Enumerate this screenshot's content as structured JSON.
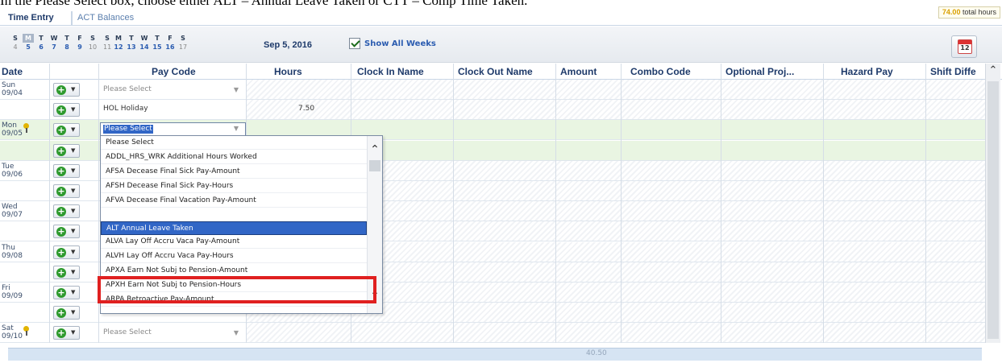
{
  "caption": "In the Please Select box, choose either ALT – Annual Leave Taken or CTT – Comp Time Taken.",
  "tabs": [
    "Time Entry",
    "ACT Balances"
  ],
  "total_hours": {
    "value": "74.00",
    "label": "total hours"
  },
  "calendar": {
    "day_headers": [
      "S",
      "M",
      "T",
      "W",
      "T",
      "F",
      "S",
      "S",
      "M",
      "T",
      "W",
      "T",
      "F",
      "S"
    ],
    "dates": [
      "4",
      "5",
      "6",
      "7",
      "8",
      "9",
      "10",
      "11",
      "12",
      "13",
      "14",
      "15",
      "16",
      "17"
    ]
  },
  "week_date": "Sep 5, 2016",
  "show_all_weeks": {
    "label": "Show All Weeks",
    "checked": true
  },
  "columns": [
    "Date",
    "Pay Code",
    "Hours",
    "Clock In Name",
    "Clock Out Name",
    "Amount",
    "Combo Code",
    "Optional Proj...",
    "Hazard Pay",
    "Shift Diffe"
  ],
  "rows": [
    {
      "date": "Sun\n09/04",
      "pay_code": "Please Select",
      "hours": ""
    },
    {
      "date": "",
      "pay_code": "HOL Holiday",
      "hours": "7.50"
    },
    {
      "date": "Mon\n09/05",
      "pay_code": "Please Select",
      "hours": ""
    },
    {
      "date": "",
      "pay_code": "",
      "hours": ""
    },
    {
      "date": "Tue\n09/06",
      "pay_code": "",
      "hours": ""
    },
    {
      "date": "",
      "pay_code": "",
      "hours": ""
    },
    {
      "date": "Wed\n09/07",
      "pay_code": "",
      "hours": ""
    },
    {
      "date": "",
      "pay_code": "",
      "hours": ""
    },
    {
      "date": "Thu\n09/08",
      "pay_code": "",
      "hours": ""
    },
    {
      "date": "",
      "pay_code": "",
      "hours": ""
    },
    {
      "date": "Fri\n09/09",
      "pay_code": "",
      "hours": ""
    },
    {
      "date": "",
      "pay_code": "",
      "hours": ""
    },
    {
      "date": "Sat\n09/10",
      "pay_code": "Please Select",
      "hours": ""
    }
  ],
  "dropdown": {
    "items": [
      "Please Select",
      "ADDL_HRS_WRK Additional Hours Worked",
      "AFSA Decease Final Sick Pay-Amount",
      "AFSH Decease Final Sick Pay-Hours",
      "AFVA Decease Final Vacation Pay-Amount",
      "ALT Annual Leave Taken",
      "ALVA Lay Off Accru Vaca Pay-Amount",
      "ALVH Lay Off Accru Vaca Pay-Hours",
      "APXA Earn Not Subj to Pension-Amount",
      "APXH Earn Not Subj to Pension-Hours",
      "ARPA Retroactive Pay-Amount"
    ],
    "selected": "ALT Annual Leave Taken"
  },
  "total_row_hours": "40.50",
  "icons": {
    "add": "plus-circle-icon",
    "calendar": "calendar-icon",
    "pin": "pin-icon"
  }
}
